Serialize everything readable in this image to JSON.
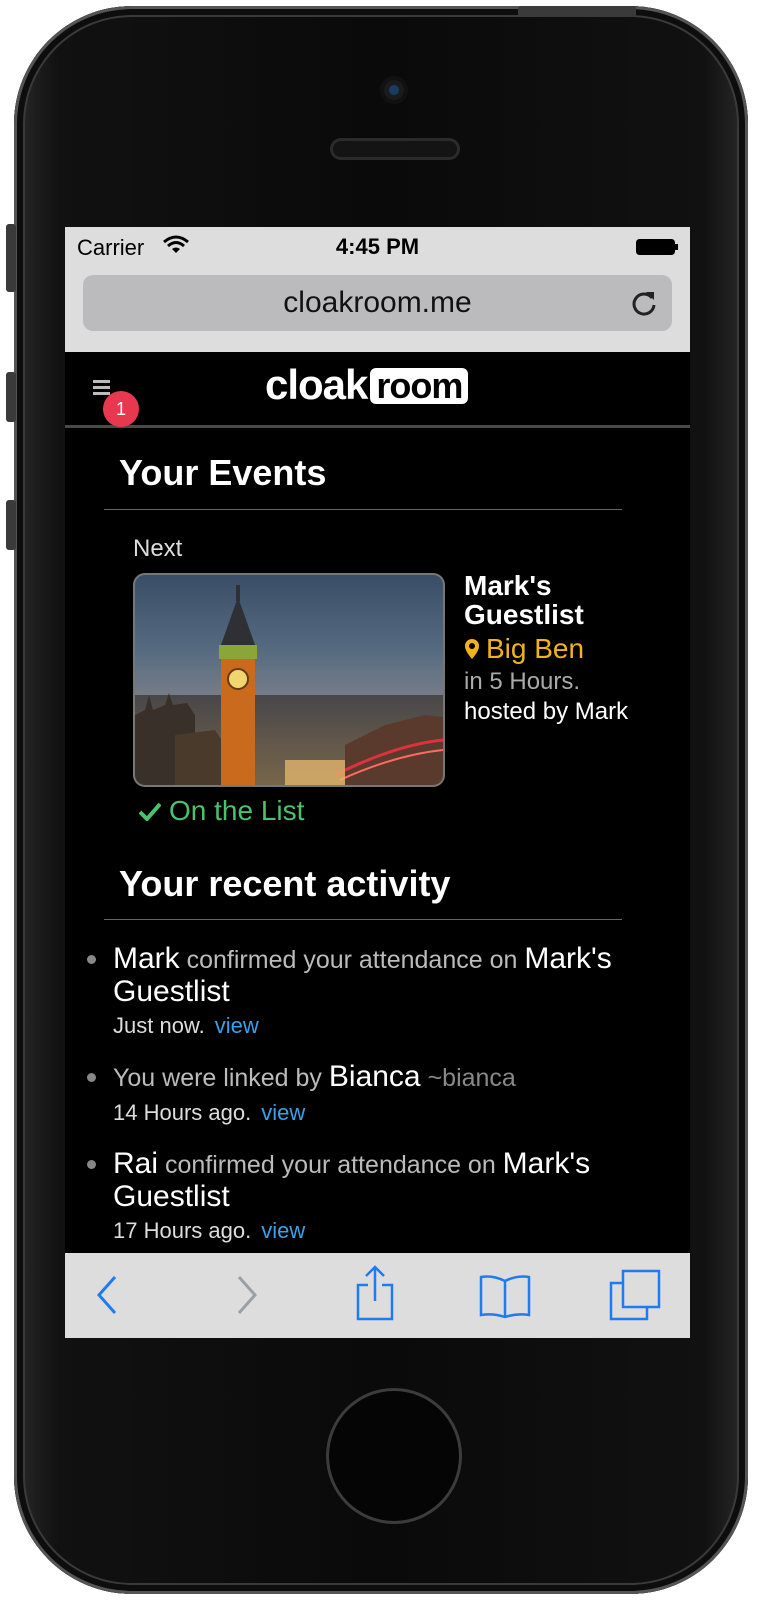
{
  "status_bar": {
    "carrier": "Carrier",
    "time": "4:45 PM"
  },
  "browser": {
    "url": "cloakroom.me"
  },
  "header": {
    "logo_part1": "cloak",
    "logo_part2": "room",
    "notification_count": "1"
  },
  "events": {
    "title": "Your Events",
    "next_label": "Next",
    "event": {
      "name": "Mark's Guestlist",
      "venue": "Big Ben",
      "when": "in 5 Hours.",
      "host": "hosted by Mark",
      "status": "On the List"
    }
  },
  "activity": {
    "title": "Your recent activity",
    "items": [
      {
        "actor": "Mark",
        "text": " confirmed your attendance on ",
        "target": "Mark's Guestlist",
        "extra": "",
        "time": "Just now.",
        "link": "view"
      },
      {
        "actor": "",
        "text": "You were linked by ",
        "target": "Bianca",
        "extra": " ~bianca",
        "time": "14 Hours ago.",
        "link": "view"
      },
      {
        "actor": "Rai",
        "text": " confirmed your attendance on ",
        "target": "Mark's Guestlist",
        "extra": "",
        "time": "17 Hours ago.",
        "link": "view"
      }
    ]
  },
  "colors": {
    "accent_link": "#3aa1e8",
    "venue": "#f2b31a",
    "status_ok": "#49c26b",
    "badge": "#e8384f",
    "toolbar_icons": "#1e7cf0"
  },
  "icons": [
    "wifi-icon",
    "battery-icon",
    "reload-icon",
    "menu-icon",
    "pin-icon",
    "check-icon",
    "back-icon",
    "forward-icon",
    "share-icon",
    "bookmarks-icon",
    "tabs-icon"
  ]
}
